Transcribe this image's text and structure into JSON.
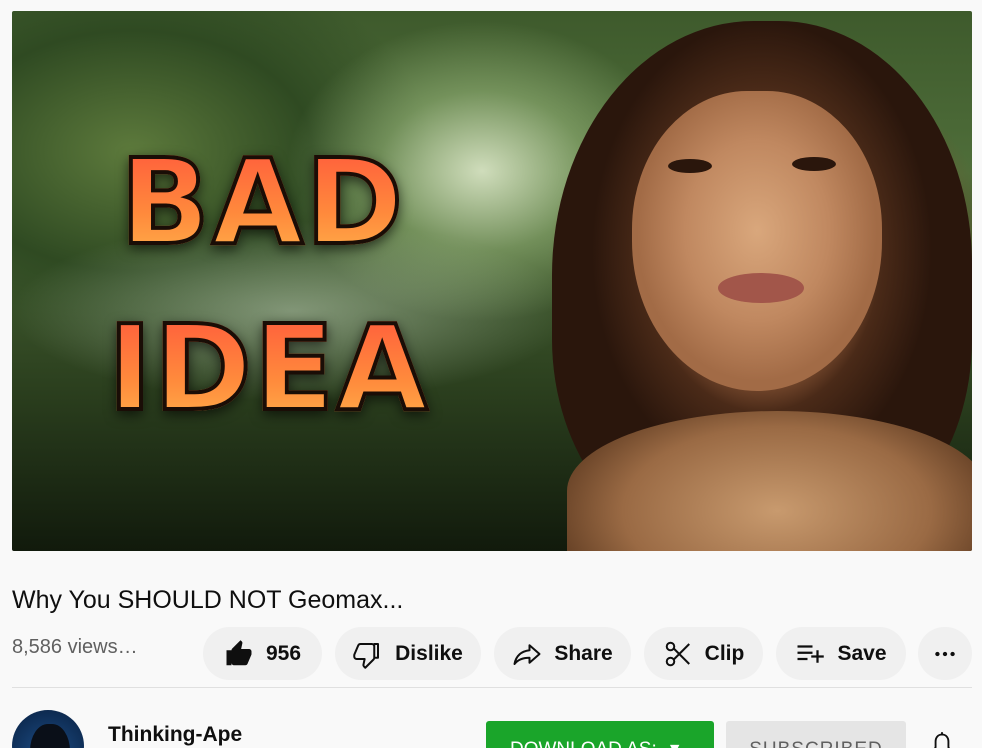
{
  "video": {
    "title": "Why You SHOULD NOT Geomax...",
    "views": "8,586 views…",
    "thumbnail": {
      "overlay_line_1": "BAD",
      "overlay_line_2": "IDEA",
      "overlay_color": "#ff7a3a"
    }
  },
  "actions": {
    "like_count": "956",
    "dislike_label": "Dislike",
    "share_label": "Share",
    "clip_label": "Clip",
    "save_label": "Save",
    "more_icon": "more-horizontal-icon"
  },
  "channel": {
    "name": "Thinking-Ape",
    "download_label": "DOWNLOAD AS:",
    "download_color": "#1aa52a",
    "subscribe_label": "SUBSCRIBED"
  }
}
